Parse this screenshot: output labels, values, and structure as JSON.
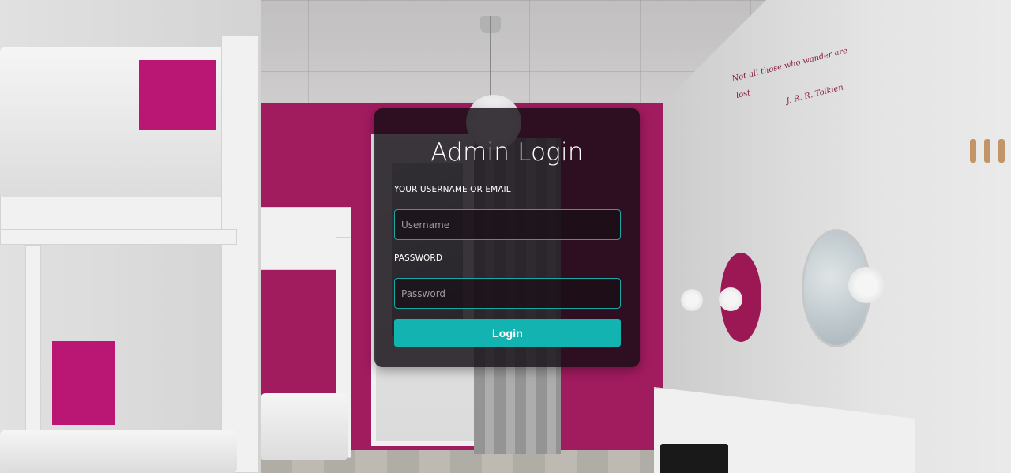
{
  "background": {
    "quote_line": "Not all those who wander are lost",
    "quote_author": "J. R. R. Tolkien",
    "colors": {
      "accent_wall": "#a81d63",
      "bunk_panel": "#c2187a"
    }
  },
  "login": {
    "title": "Admin Login",
    "username_label": "YOUR USERNAME OR EMAIL",
    "username_placeholder": "Username",
    "username_value": "",
    "password_label": "PASSWORD",
    "password_placeholder": "Password",
    "password_value": "",
    "submit_label": "Login",
    "colors": {
      "button": "#12b3b1",
      "input_border": "#1aa6a3",
      "card_bg": "rgba(20,14,20,0.82)"
    }
  }
}
